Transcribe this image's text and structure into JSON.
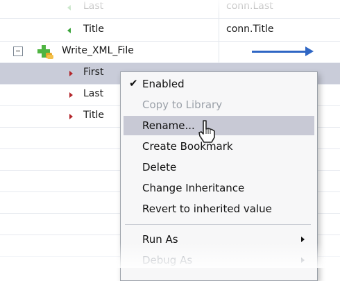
{
  "tree": {
    "rows": [
      {
        "label": "Last",
        "value": "conn.Last"
      },
      {
        "label": "Title",
        "value": "conn.Title"
      },
      {
        "label": "Write_XML_File",
        "value": ""
      },
      {
        "label": "First",
        "value": ""
      },
      {
        "label": "Last",
        "value": ""
      },
      {
        "label": "Title",
        "value": ""
      }
    ]
  },
  "menu": {
    "items": [
      {
        "label": "Enabled",
        "checked": true,
        "enabled": true
      },
      {
        "label": "Copy to Library",
        "enabled": false
      },
      {
        "label": "Rename...",
        "enabled": true,
        "highlighted": true
      },
      {
        "label": "Create Bookmark",
        "enabled": true
      },
      {
        "label": "Delete",
        "enabled": true
      },
      {
        "label": "Change Inheritance",
        "enabled": true
      },
      {
        "label": "Revert to inherited value",
        "enabled": true
      },
      {
        "label": "Run As",
        "enabled": true,
        "submenu": true
      },
      {
        "label": "Debug As",
        "enabled": false,
        "submenu": true
      }
    ]
  },
  "colors": {
    "selection": "#c9ccd9",
    "arrow": "#2f66c4",
    "output_marker": "#3aa33a",
    "input_marker": "#b3262b"
  },
  "icons": {
    "component": "plus-puzzle-icon",
    "expander": "minus-expander-icon",
    "check": "checkmark-icon",
    "submenu": "chevron-right-icon",
    "cursor": "pointer-cursor-icon",
    "mapping": "arrow-right-icon"
  }
}
